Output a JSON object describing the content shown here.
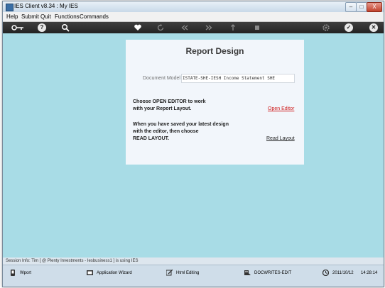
{
  "window": {
    "title": "IES Client v8.34 : My IES",
    "controls": {
      "minimize": "–",
      "maximize": "□",
      "close": "X"
    }
  },
  "menu": [
    "Help",
    "Submit",
    "Quit",
    "Functions",
    "Commands"
  ],
  "toolbar": {
    "icons": [
      "key-icon",
      "help-icon",
      "search-icon",
      "heart-icon",
      "refresh-icon",
      "rewind-icon",
      "fast-forward-icon",
      "upload-icon",
      "stop-icon",
      "settings-icon",
      "check-icon",
      "close-icon"
    ],
    "help_glyph": "?",
    "check_glyph": "✓",
    "close_glyph": "✕"
  },
  "report": {
    "title": "Report Design",
    "document_model_label": "Document Model",
    "document_model_value": "ISTATE-SHE-IESH Income Statement SHE",
    "instruction1_line1": "Choose OPEN EDITOR to work",
    "instruction1_line2": "with your Report Layout.",
    "open_editor_link": "Open Editor",
    "instruction2_line1": "When you have saved your latest design",
    "instruction2_line2": "with the editor, then choose",
    "instruction2_line3": "READ LAYOUT.",
    "read_layout_link": "Read Layout"
  },
  "session_info": "Session Info: Tim [ @ Plenty Investments   - Iesbusiness1 ] is using IES",
  "statusbar": {
    "wport": "Wport",
    "app_wizard": "Application Wizard",
    "html_editing": "Html Editing",
    "docwrites": "DOCWRITES-EDIT",
    "date": "2011/10/12",
    "time": "14:28:14"
  },
  "colors": {
    "content_bg": "#a8dce6",
    "toolbar_bg": "#2e2e2e",
    "panel_bg": "#f2f6fb",
    "link_red": "#d02020"
  }
}
